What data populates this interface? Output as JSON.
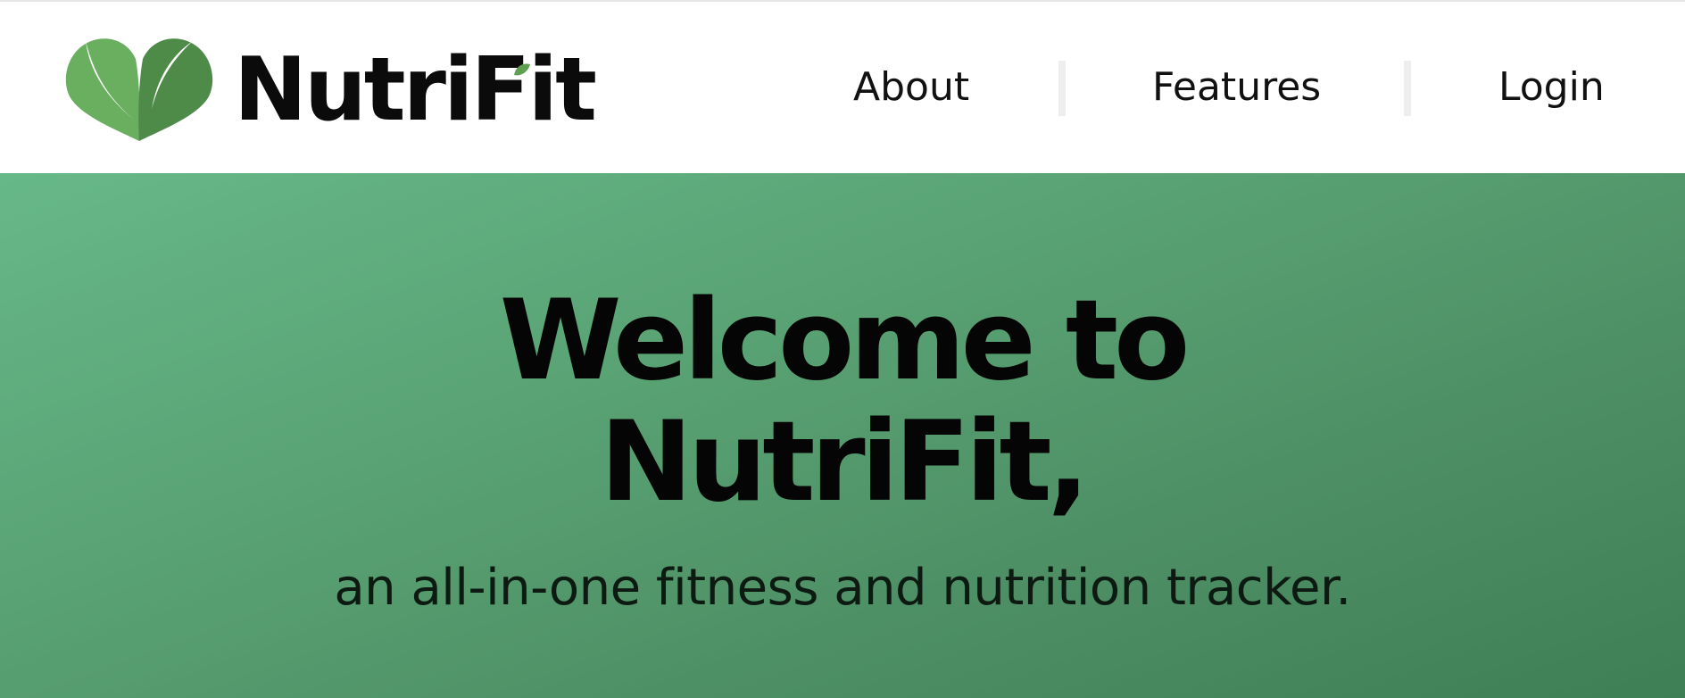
{
  "brand": {
    "name": "NutriFit",
    "logo_icon": "heart-leaf-icon",
    "colors": {
      "leaf_light": "#6aae5f",
      "leaf_dark": "#4e8a48",
      "text": "#0b0b0b"
    }
  },
  "nav": {
    "items": [
      {
        "label": "About"
      },
      {
        "label": "Features"
      },
      {
        "label": "Login"
      }
    ]
  },
  "hero": {
    "title_line1": "Welcome to",
    "title_line2": "NutriFit,",
    "subtitle": "an all-in-one fitness and nutrition tracker.",
    "colors": {
      "gradient_start": "#67b889",
      "gradient_end": "#3f7f55"
    }
  }
}
